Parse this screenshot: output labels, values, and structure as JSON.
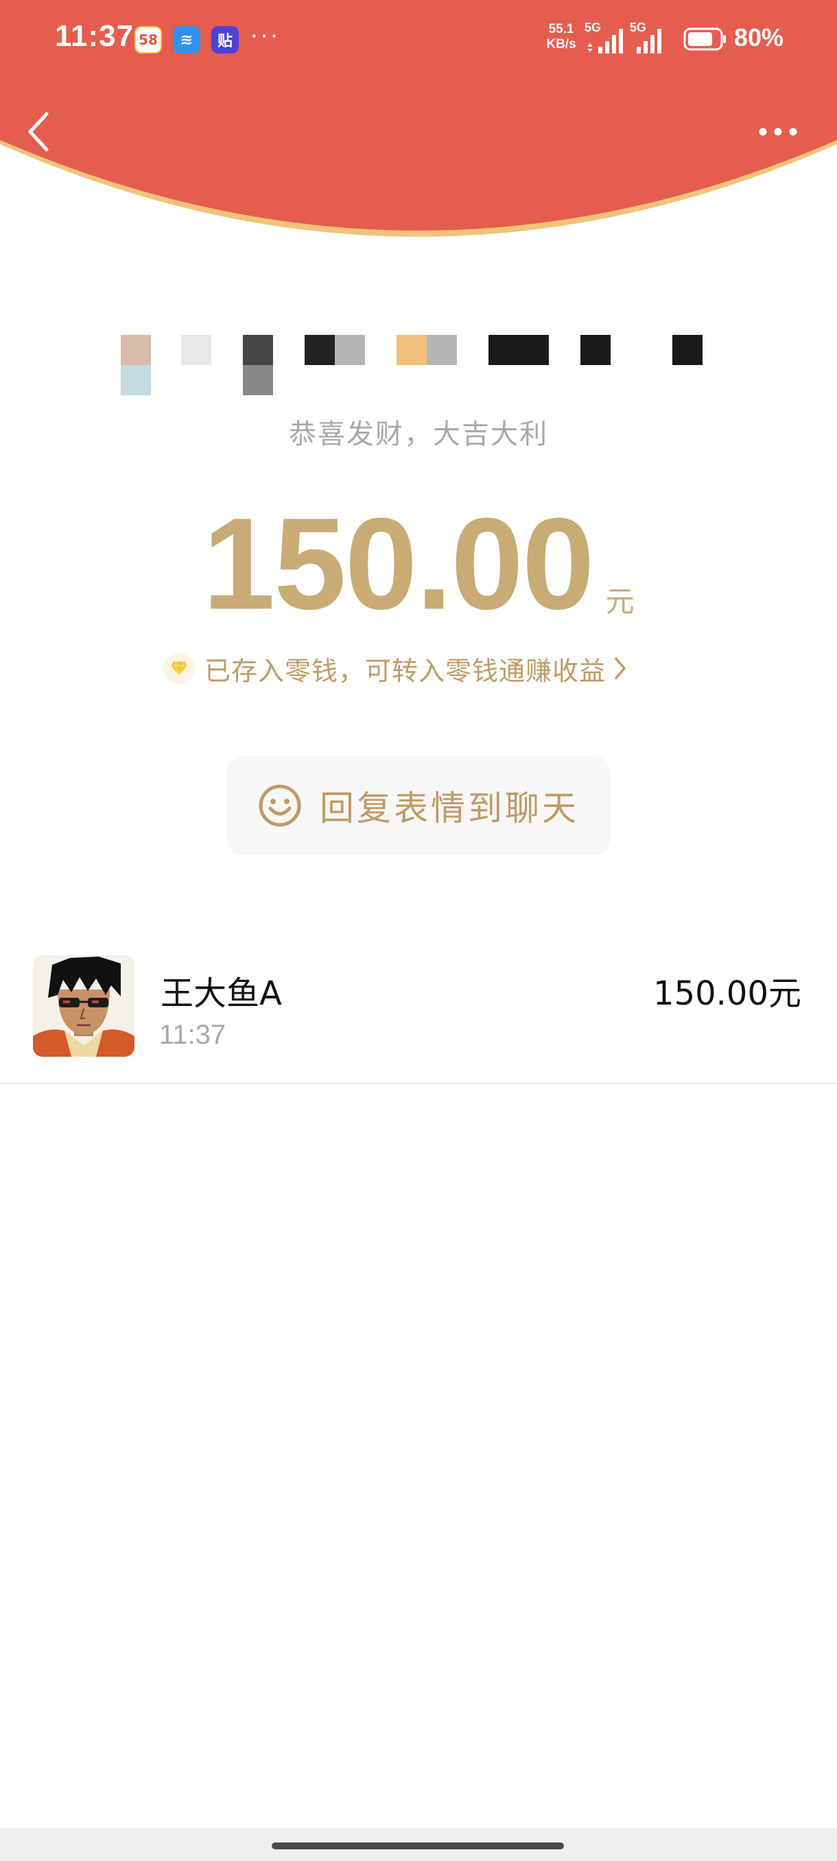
{
  "status_bar": {
    "time": "11:37",
    "app_icons": [
      "58",
      "≋",
      "贴"
    ],
    "more": "···",
    "net_speed_value": "55.1",
    "net_speed_unit": "KB/s",
    "signal_1_label": "5G",
    "signal_2_label": "5G",
    "battery_percent": "80%",
    "battery_level": 0.8
  },
  "nav": {
    "back_icon": "chevron-left-icon",
    "more_icon": "more-horizontal-icon"
  },
  "envelope": {
    "header_color": "#e55d4e",
    "header_border_color": "#f0c47a",
    "greeting": "恭喜发财，大吉大利",
    "amount": "150.00",
    "unit": "元",
    "change_notice": "已存入零钱，可转入零钱通赚收益",
    "gold_color": "#c8ab75"
  },
  "reply": {
    "label": "回复表情到聊天",
    "icon": "smile-icon"
  },
  "recipient": {
    "name": "王大鱼A",
    "time": "11:37",
    "amount": "150.00元",
    "avatar": "cartoon-avatar-icon"
  }
}
